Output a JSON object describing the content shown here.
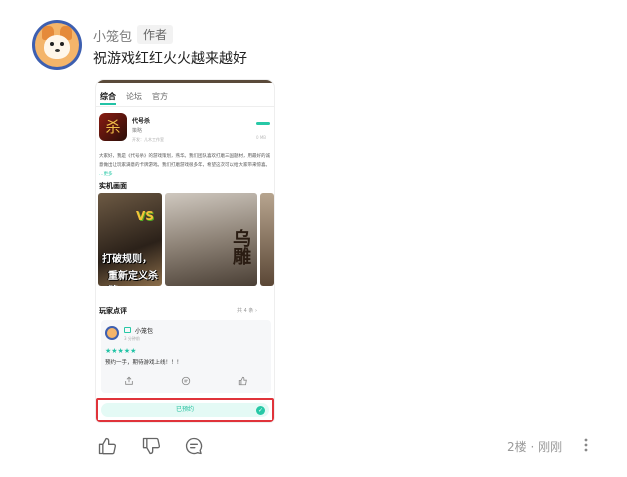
{
  "post": {
    "username": "小笼包",
    "author_tag": "作者",
    "comment": "祝游戏红红火火越来越好",
    "floor_time": "2楼 · 刚刚"
  },
  "embedded": {
    "tabs": [
      "综合",
      "论坛",
      "官方"
    ],
    "app": {
      "name": "代号杀",
      "icon_char": "杀",
      "genre": "策略",
      "developer": "开发：儿木工作室",
      "size": "0 MB"
    },
    "description": "大家好，我是《代号杀》的游戏策划，燕华。我们团队喜欢打磨三国题材，用最好的诚意做出让玩家满意的卡牌游戏。我们打磨游戏很多年，希望这次可以给大家带来惊喜。",
    "description_more": "…更多",
    "screenshots_title": "实机画面",
    "slogan_line1": "打破规则，",
    "slogan_line2": "重新定义杀牌！",
    "vs_text": "VS",
    "big_char": "乌雕",
    "reviews_title": "玩家点评",
    "reviews_count": "共 4 条 ›",
    "review": {
      "name": "小笼包",
      "time": "3 分钟前",
      "stars": "★★★★★",
      "text": "预约一手，期待游戏上线！！！"
    },
    "reserve_label": "已预约",
    "reserve_check": "✓"
  },
  "icons": {
    "like": "thumbs-up-icon",
    "dislike": "thumbs-down-icon",
    "comment": "comment-icon",
    "more": "more-vertical-icon"
  },
  "colors": {
    "accent": "#22c3a6",
    "highlight_border": "#e0333a"
  }
}
